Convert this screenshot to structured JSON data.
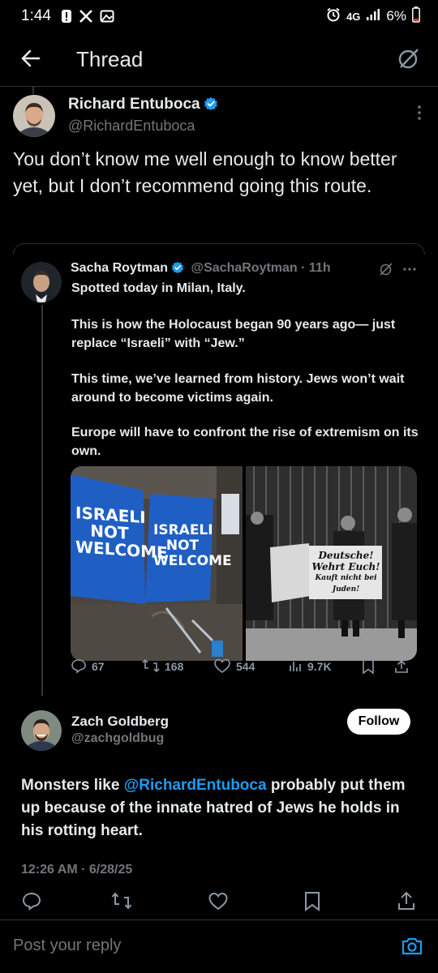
{
  "status_bar": {
    "time": "1:44",
    "network": "4G",
    "battery": "6%",
    "icons": [
      "notification-icon",
      "x-icon",
      "image-icon",
      "alarm-icon",
      "signal-icon",
      "battery-icon"
    ]
  },
  "header": {
    "title": "Thread"
  },
  "main_tweet": {
    "author_name": "Richard Entuboca",
    "handle": "@RichardEntuboca",
    "text": "You don’t know me well enough to know better yet, but I don’t recommend going this route."
  },
  "quoted_tweet": {
    "author_name": "Sacha Roytman",
    "handle": "@SachaRoytman",
    "time": "· 11h",
    "paragraphs": [
      "Spotted today in Milan, Italy.",
      "This is how the Holocaust began 90 years ago— just replace “Israeli” with “Jew.”",
      "This time, we’ve learned from history. Jews won’t wait around to become victims again.",
      "Europe will have to confront the rise of extremism on its own."
    ],
    "media": {
      "left_sign_1": [
        "ISRAELI",
        "NOT",
        "WELCOME"
      ],
      "left_sign_2": [
        "ISRAELI",
        "NOT",
        "WELCOME"
      ],
      "right_sign": [
        "Deutsche!",
        "Wehrt Euch!",
        "Kauft nicht bei Juden!"
      ]
    },
    "stats": {
      "replies": "67",
      "reposts": "168",
      "likes": "544",
      "views": "9.7K"
    }
  },
  "reply": {
    "author_name": "Zach Goldberg",
    "handle": "@zachgoldbug",
    "follow_label": "Follow",
    "text_before": "Monsters like ",
    "mention": "@RichardEntuboca",
    "text_after": " probably put them up because of the innate hatred of Jews he holds in his rotting heart.",
    "timestamp": "12:26 AM · 6/28/25"
  },
  "composer": {
    "placeholder": "Post your reply"
  },
  "colors": {
    "background": "#000000",
    "accent": "#1d9bf0",
    "text": "#e7e9ea",
    "muted": "#71767b",
    "sign_blue": "#1f5fc4"
  }
}
